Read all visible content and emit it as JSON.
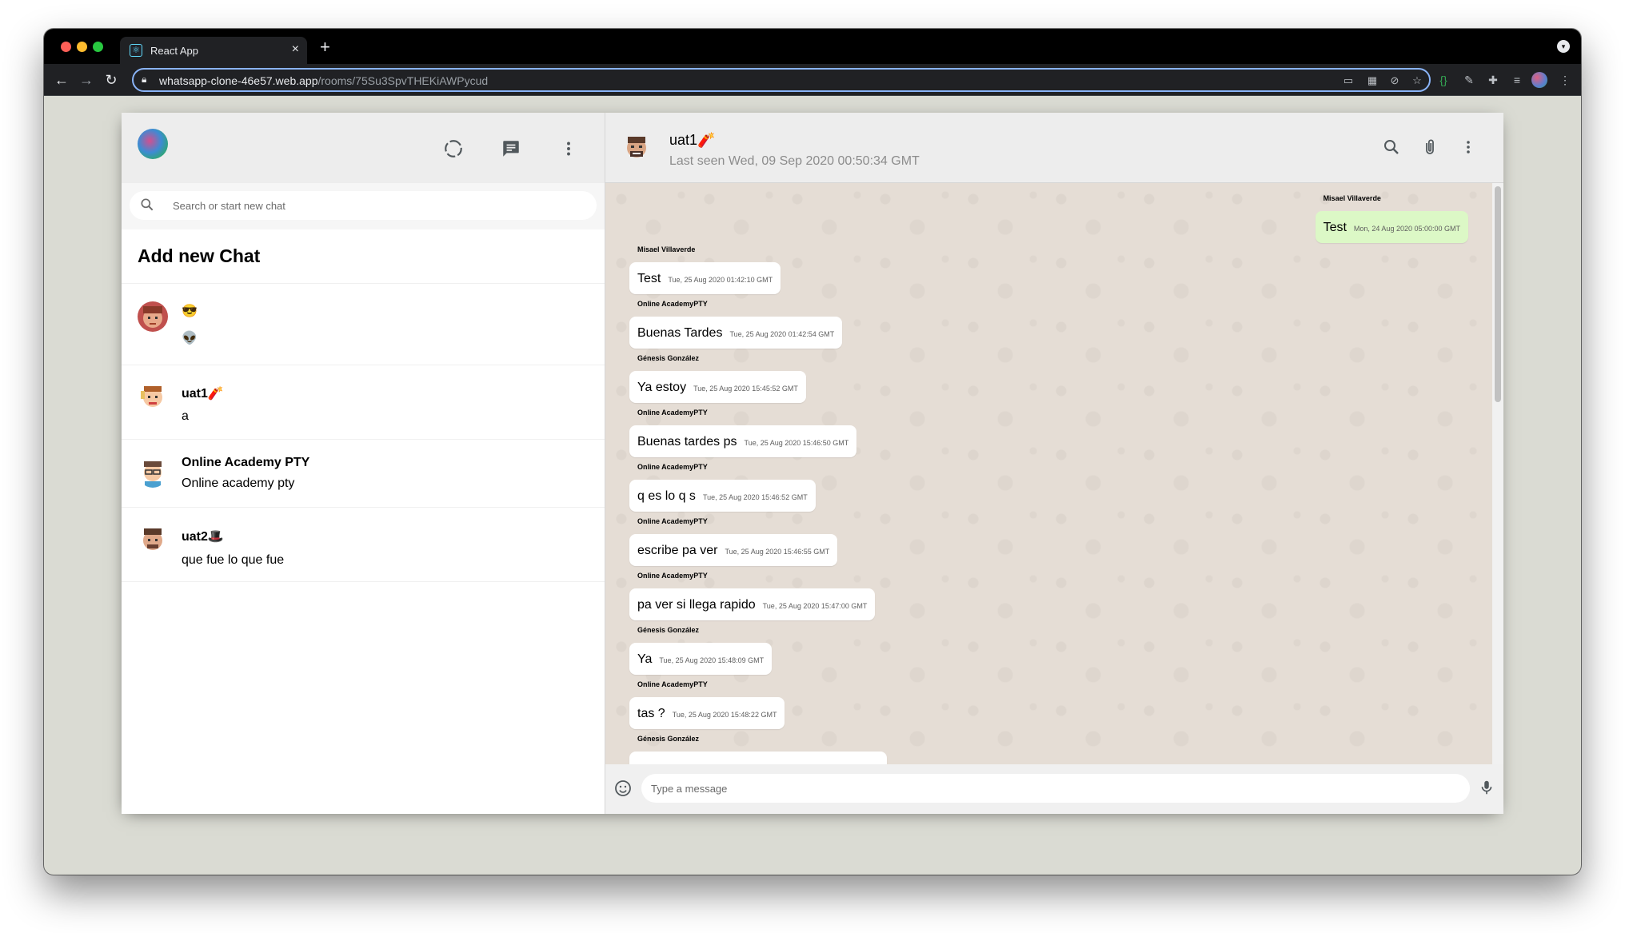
{
  "browser": {
    "tab_title": "React App",
    "tab_close": "×",
    "new_tab": "+",
    "url_host": "whatsapp-clone-46e57.web.app",
    "url_path": "/rooms/75Su3SpvTHEKiAWPycud"
  },
  "sidebar": {
    "search_placeholder": "Search or start new chat",
    "add_chat_label": "Add new Chat",
    "chats": [
      {
        "name": "😎",
        "last_message": "👽"
      },
      {
        "name": "uat1🧨",
        "last_message": "a"
      },
      {
        "name": "Online Academy PTY",
        "last_message": "Online academy pty"
      },
      {
        "name": "uat2🎩",
        "last_message": "que fue lo que fue"
      }
    ]
  },
  "chat": {
    "room_name": "uat1🧨",
    "last_seen": "Last seen Wed, 09 Sep 2020 00:50:34 GMT",
    "messages": [
      {
        "sender": "Misael Villaverde",
        "text": "Test",
        "time": "Mon, 24 Aug 2020 05:00:00 GMT",
        "sent": true
      },
      {
        "sender": "Misael Villaverde",
        "text": "Test",
        "time": "Tue, 25 Aug 2020 01:42:10 GMT",
        "sent": false
      },
      {
        "sender": "Online AcademyPTY",
        "text": "Buenas Tardes",
        "time": "Tue, 25 Aug 2020 01:42:54 GMT",
        "sent": false
      },
      {
        "sender": "Génesis González",
        "text": "Ya estoy",
        "time": "Tue, 25 Aug 2020 15:45:52 GMT",
        "sent": false
      },
      {
        "sender": "Online AcademyPTY",
        "text": "Buenas tardes ps",
        "time": "Tue, 25 Aug 2020 15:46:50 GMT",
        "sent": false
      },
      {
        "sender": "Online AcademyPTY",
        "text": "q es lo q s",
        "time": "Tue, 25 Aug 2020 15:46:52 GMT",
        "sent": false
      },
      {
        "sender": "Online AcademyPTY",
        "text": "escribe pa ver",
        "time": "Tue, 25 Aug 2020 15:46:55 GMT",
        "sent": false
      },
      {
        "sender": "Online AcademyPTY",
        "text": "pa ver si llega rapido",
        "time": "Tue, 25 Aug 2020 15:47:00 GMT",
        "sent": false
      },
      {
        "sender": "Génesis González",
        "text": "Ya",
        "time": "Tue, 25 Aug 2020 15:48:09 GMT",
        "sent": false
      },
      {
        "sender": "Online AcademyPTY",
        "text": "tas ?",
        "time": "Tue, 25 Aug 2020 15:48:22 GMT",
        "sent": false
      },
      {
        "sender": "Génesis González",
        "text": "",
        "time": "",
        "sent": false
      }
    ],
    "input_placeholder": "Type a message"
  },
  "icons": {
    "status": "status-icon",
    "new_chat": "message-icon",
    "menu": "more-vert-icon",
    "search": "search-icon",
    "attach": "attach-icon",
    "emoji": "emoji-icon",
    "mic": "mic-icon"
  },
  "colors": {
    "chat_background": "#e5ddd5",
    "sent_bubble": "#dcf8c6",
    "received_bubble": "#ffffff",
    "header_background": "#ededed"
  }
}
